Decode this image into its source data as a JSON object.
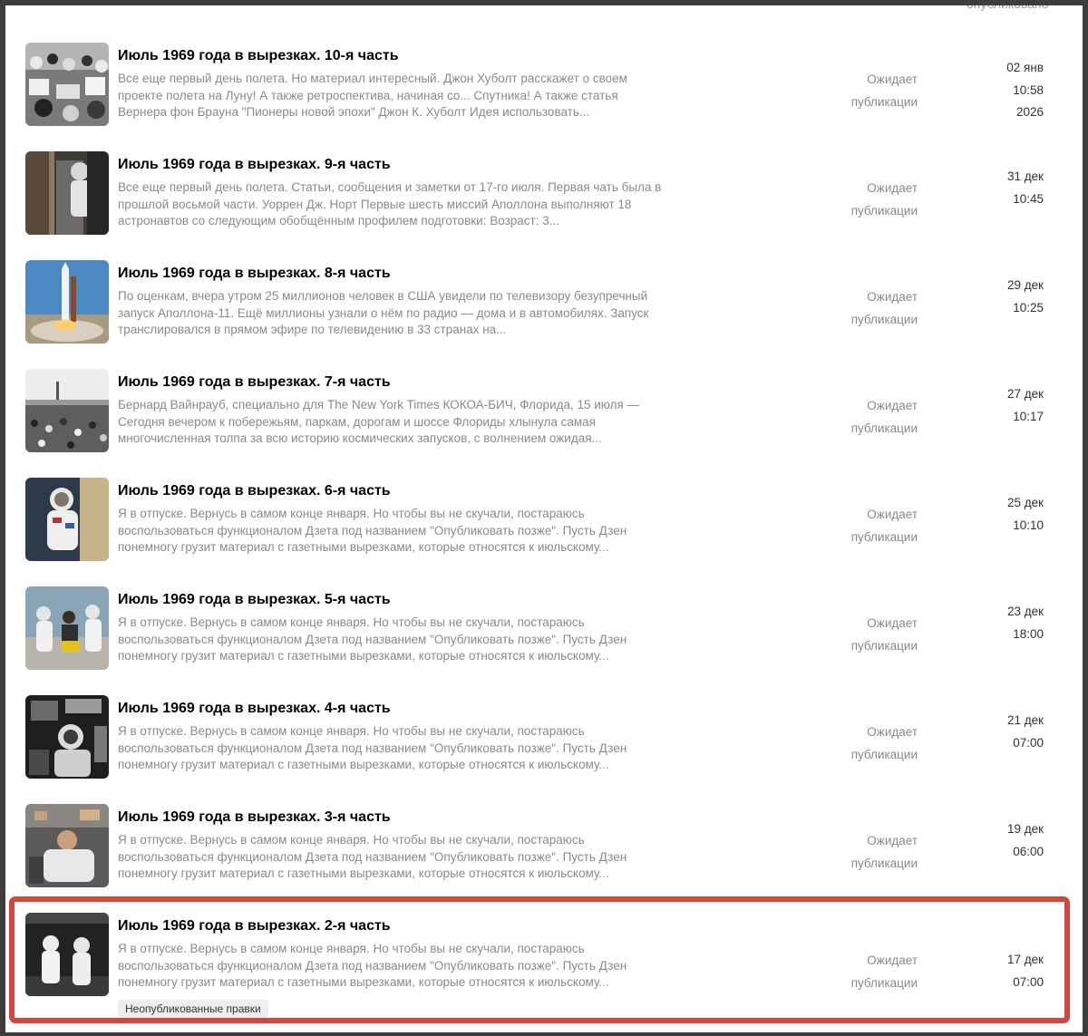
{
  "top_cut_text": "опубликовано",
  "badge_label": "Неопубликованные правки",
  "colors": {
    "highlight_border": "#d1473e",
    "frame_border": "#3d3d3d",
    "muted_text": "#8a8a8a"
  },
  "articles": [
    {
      "title": "Июль 1969 года в вырезках. 10-я часть",
      "excerpt": "Все еще первый день полета. Но материал интересный. Джон Хуболт расскажет о своем проекте полета на Луну! А также ретроспектива, начиная со... Спутника! А также статья Вернера фон Брауна \"Пионеры новой эпохи\" Джон К. Хуболт Идея использовать...",
      "status_line1": "Ожидает",
      "status_line2": "публикации",
      "date_day": "02 янв",
      "date_time": "10:58",
      "date_year": "2026",
      "thumbnail": "crowd-photo-icon"
    },
    {
      "title": "Июль 1969 года в вырезках. 9-я часть",
      "excerpt": "Все еще первый день полета. Статьи, сообщения и заметки от 17-го июля. Первая чать была в прошлой восьмой части. Уоррен Дж. Норт Первые шесть миссий Аполлона выполняют 18 астронавтов со следующим обобщённым профилем подготовки: Возраст: 3...",
      "status_line1": "Ожидает",
      "status_line2": "публикации",
      "date_day": "31 дек",
      "date_time": "10:45",
      "thumbnail": "astronaut-walkway-photo-icon"
    },
    {
      "title": "Июль 1969 года в вырезках. 8-я часть",
      "excerpt": "По оценкам, вчера утром 25 миллионов человек в США увидели по телевизору безупречный запуск Аполлона-11. Ещё миллионы узнали о нём по радио — дома и в автомобилях. Запуск транслировался в прямом эфире по телевидению в 33 странах на...",
      "status_line1": "Ожидает",
      "status_line2": "публикации",
      "date_day": "29 дек",
      "date_time": "10:25",
      "thumbnail": "rocket-launch-photo-icon"
    },
    {
      "title": "Июль 1969 года в вырезках. 7-я часть",
      "excerpt": "Бернард Вайнрауб, специально для The New York Times КОКОА-БИЧ, Флорида, 15 июля — Сегодня вечером к побережьям, паркам, дорогам и шоссе Флориды хлынула самая многочисленная толпа за всю историю космических запусков, с волнением ожидая...",
      "status_line1": "Ожидает",
      "status_line2": "публикации",
      "date_day": "27 дек",
      "date_time": "10:17",
      "thumbnail": "spectators-photo-icon"
    },
    {
      "title": "Июль 1969 года в вырезках. 6-я часть",
      "excerpt": "Я в отпуске. Вернусь в самом конце января. Но чтобы вы не скучали, постараюсь воспользоваться функционалом Дзета под названием \"Опубликовать позже\". Пусть Дзен понемногу грузит материал с газетными вырезками, которые относятся к июльскому...",
      "status_line1": "Ожидает",
      "status_line2": "публикации",
      "date_day": "25 дек",
      "date_time": "10:10",
      "thumbnail": "astronaut-suit-photo-icon"
    },
    {
      "title": "Июль 1969 года в вырезках. 5-я часть",
      "excerpt": "Я в отпуске. Вернусь в самом конце января. Но чтобы вы не скучали, постараюсь воспользоваться функционалом Дзета под названием \"Опубликовать позже\". Пусть Дзен понемногу грузит материал с газетными вырезками, которые относятся к июльскому...",
      "status_line1": "Ожидает",
      "status_line2": "публикации",
      "date_day": "23 дек",
      "date_time": "18:00",
      "thumbnail": "astronauts-training-photo-icon"
    },
    {
      "title": "Июль 1969 года в вырезках. 4-я часть",
      "excerpt": "Я в отпуске. Вернусь в самом конце января. Но чтобы вы не скучали, постараюсь воспользоваться функционалом Дзета под названием \"Опубликовать позже\". Пусть Дзен понемногу грузит материал с газетными вырезками, которые относятся к июльскому...",
      "status_line1": "Ожидает",
      "status_line2": "публикации",
      "date_day": "21 дек",
      "date_time": "07:00",
      "thumbnail": "cockpit-photo-icon"
    },
    {
      "title": "Июль 1969 года в вырезках. 3-я часть",
      "excerpt": "Я в отпуске. Вернусь в самом конце января. Но чтобы вы не скучали, постараюсь воспользоваться функционалом Дзета под названием \"Опубликовать позже\". Пусть Дзен понемногу грузит материал с газетными вырезками, которые относятся к июльскому...",
      "status_line1": "Ожидает",
      "status_line2": "публикации",
      "date_day": "19 дек",
      "date_time": "06:00",
      "thumbnail": "astronaut-seat-photo-icon"
    },
    {
      "title": "Июль 1969 года в вырезках. 2-я часть",
      "excerpt": "Я в отпуске. Вернусь в самом конце января. Но чтобы вы не скучали, постараюсь воспользоваться функционалом Дзета под названием \"Опубликовать позже\". Пусть Дзен понемногу грузит материал с газетными вырезками, которые относятся к июльскому...",
      "status_line1": "Ожидает",
      "status_line2": "публикации",
      "date_day": "17 дек",
      "date_time": "07:00",
      "thumbnail": "two-astronauts-photo-icon",
      "has_badge": true
    }
  ]
}
